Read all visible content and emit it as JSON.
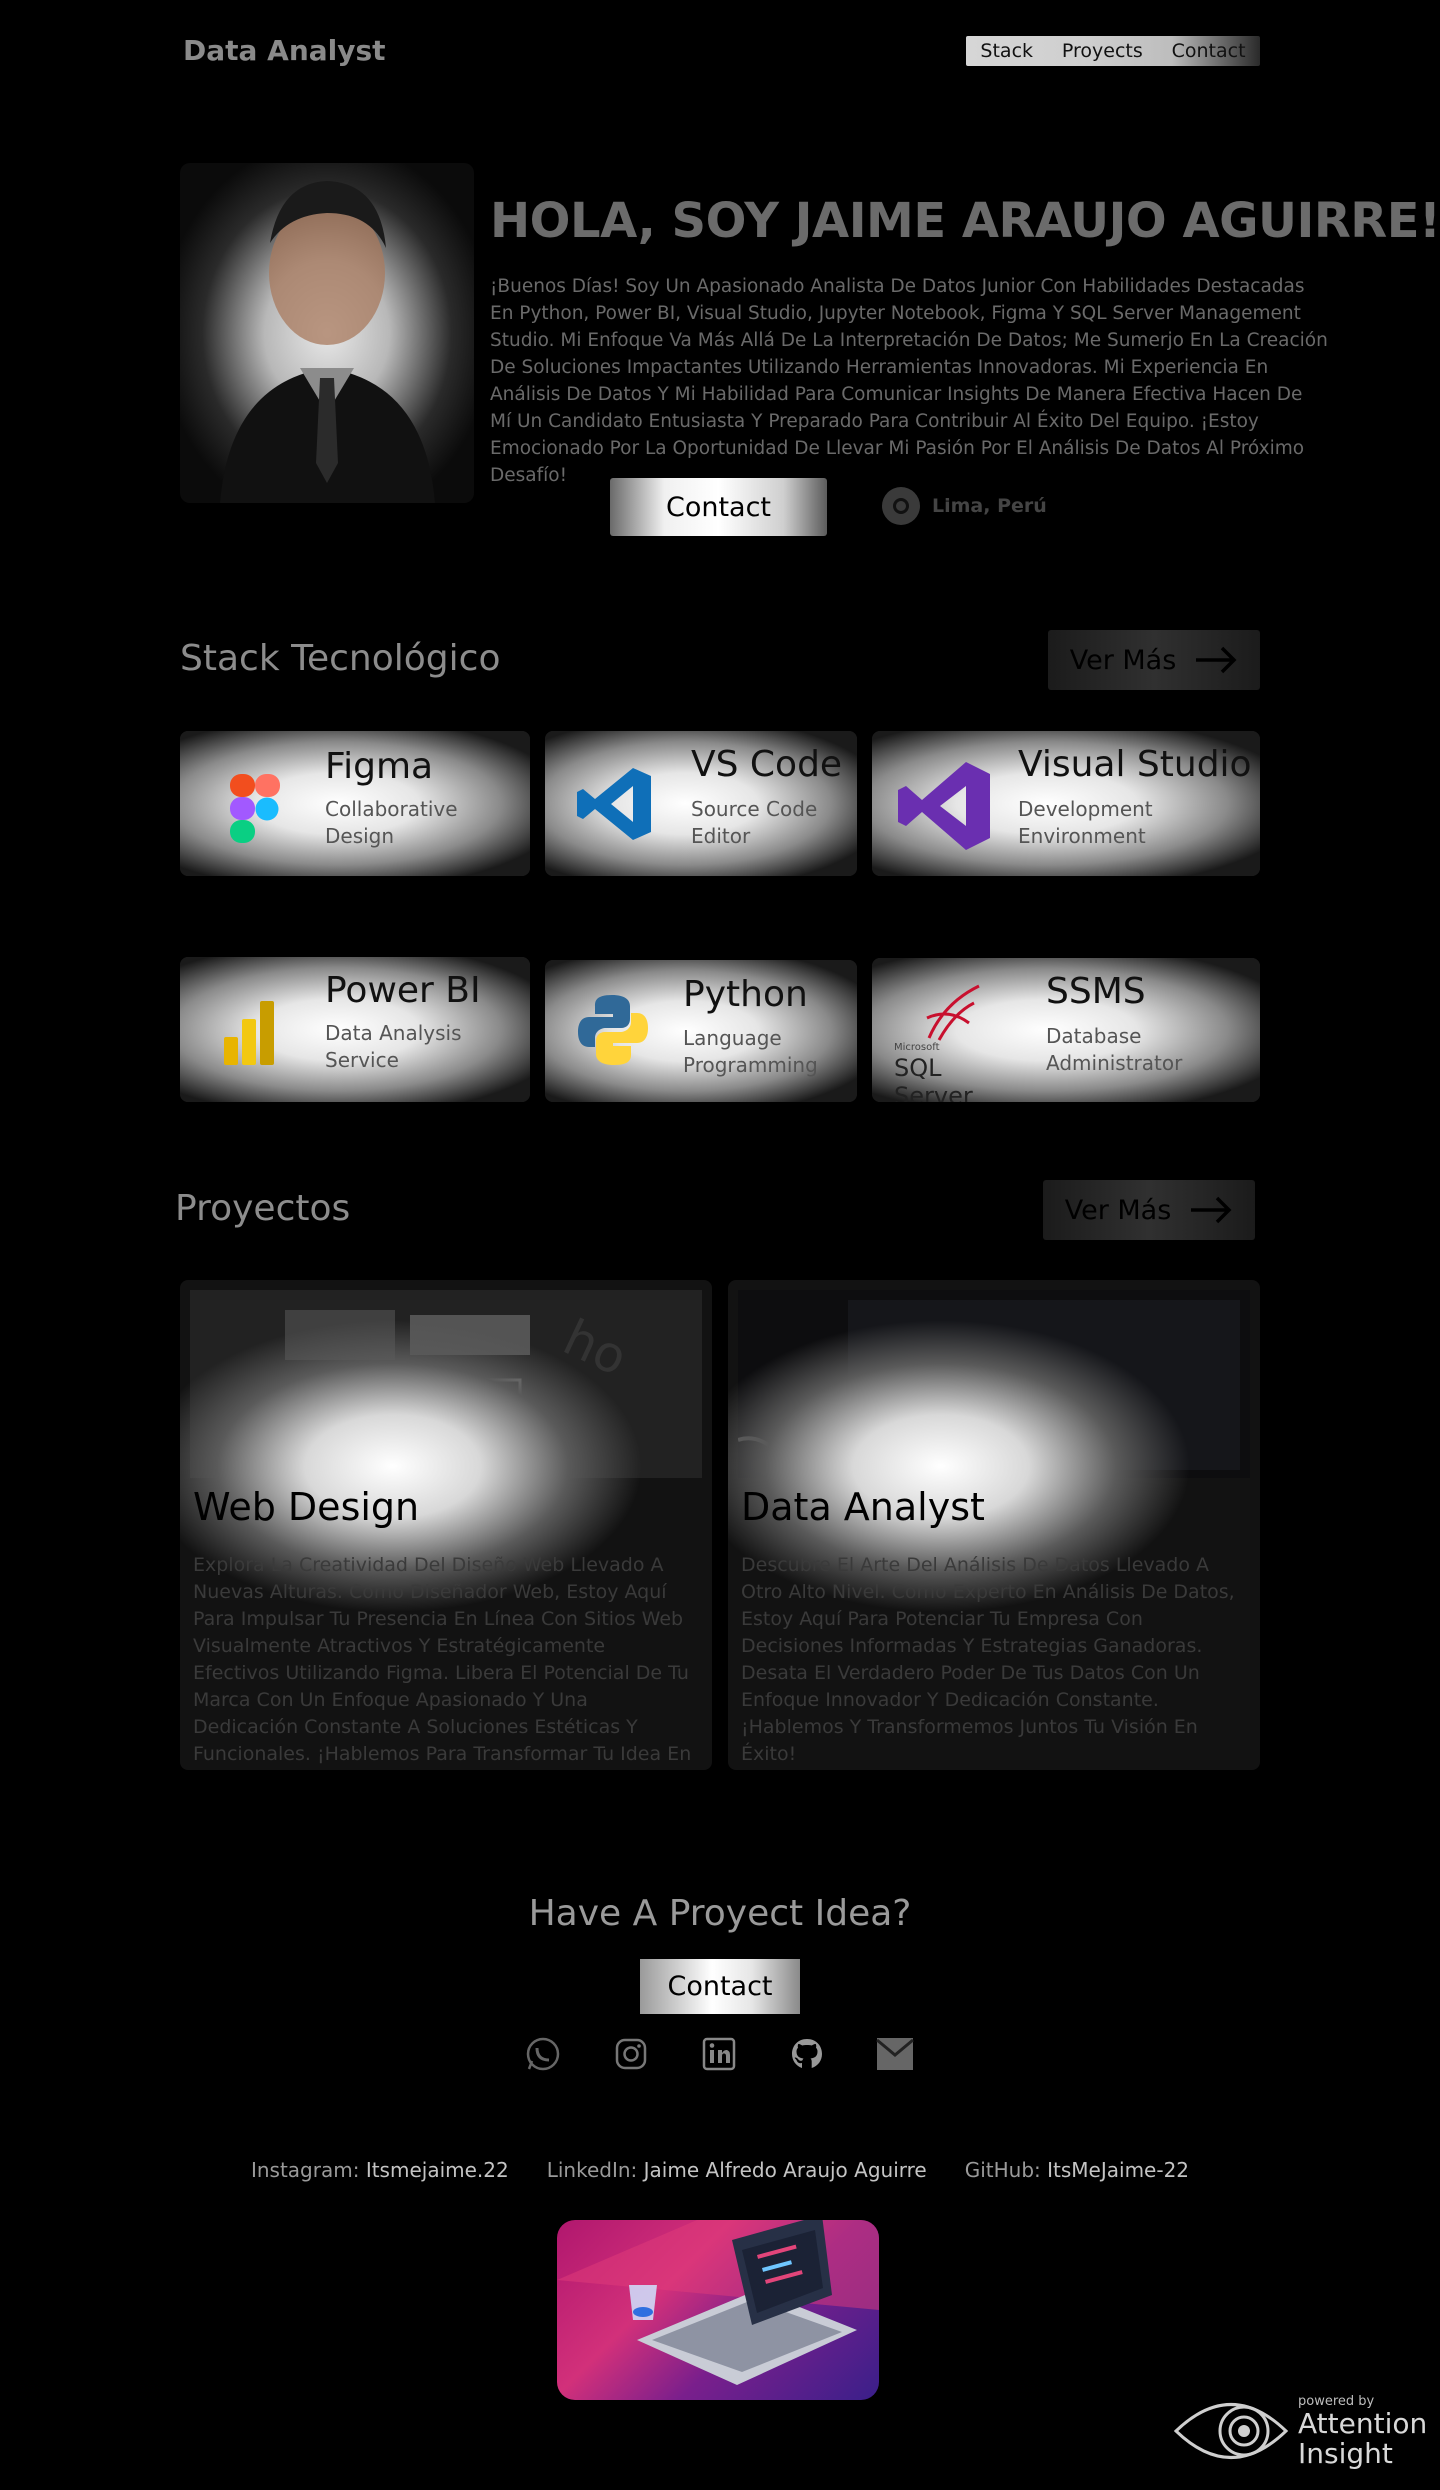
{
  "nav": {
    "brand": "Data Analyst",
    "links": [
      "Stack",
      "Proyects",
      "Contact"
    ]
  },
  "hero": {
    "title": "HOLA, SOY JAIME ARAUJO AGUIRRE!!",
    "description": "¡Buenos Días! Soy Un Apasionado Analista De Datos Junior Con Habilidades Destacadas En Python, Power BI, Visual Studio, Jupyter Notebook, Figma Y SQL Server Management Studio. Mi Enfoque Va Más Allá De La Interpretación De Datos; Me Sumerjo En La Creación De Soluciones Impactantes Utilizando Herramientas Innovadoras. Mi Experiencia En Análisis De Datos Y Mi Habilidad Para Comunicar Insights De Manera Efectiva Hacen De Mí Un Candidato Entusiasta Y Preparado Para Contribuir Al Éxito Del Equipo. ¡Estoy Emocionado Por La Oportunidad De Llevar Mi Pasión Por El Análisis De Datos Al Próximo Desafío!",
    "contact_label": "Contact",
    "location": "Lima, Perú"
  },
  "stack": {
    "title": "Stack Tecnológico",
    "more_label": "Ver Más",
    "items": [
      {
        "name": "Figma",
        "desc": "Collaborative Design"
      },
      {
        "name": "VS Code",
        "desc": "Source Code Editor"
      },
      {
        "name": "Visual Studio",
        "desc": "Development Environment"
      },
      {
        "name": "Power BI",
        "desc": "Data Analysis Service"
      },
      {
        "name": "Python",
        "desc": "Language Programming"
      },
      {
        "name": "SSMS",
        "desc": "Database Administrator"
      }
    ],
    "ssms_logo_small": "Microsoft",
    "ssms_logo_text": "SQL Server"
  },
  "projects": {
    "title": "Proyectos",
    "more_label": "Ver Más",
    "items": [
      {
        "title": "Web Design",
        "desc": "Explora La Creatividad Del Diseño Web Llevado A Nuevas Alturas. Como Diseñador Web, Estoy Aquí Para Impulsar Tu Presencia En Línea Con Sitios Web Visualmente Atractivos Y Estratégicamente Efectivos Utilizando Figma. Libera El Potencial De Tu Marca Con Un Enfoque Apasionado Y Una Dedicación Constante A Soluciones Estéticas Y Funcionales. ¡Hablemos Para Transformar Tu Idea En Realidad Digital!"
      },
      {
        "title": "Data Analyst",
        "desc": "Descubre El Arte Del Análisis De Datos Llevado A Otro Alto Nivel. Como Experto En Análisis De Datos, Estoy Aquí Para Potenciar Tu Empresa Con Decisiones Informadas Y Estrategias Ganadoras. Desata El Verdadero Poder De Tus Datos Con Un Enfoque Innovador Y Dedicación Constante. ¡Hablemos Y Transformemos Juntos Tu Visión En Éxito!"
      }
    ]
  },
  "contact": {
    "heading": "Have A Proyect Idea?",
    "button_label": "Contact",
    "socials": [
      "whatsapp-icon",
      "instagram-icon",
      "linkedin-icon",
      "github-icon",
      "mail-icon"
    ]
  },
  "footer": {
    "links": [
      {
        "label": "Instagram:",
        "value": "Itsmejaime.22"
      },
      {
        "label": "LinkedIn:",
        "value": "Jaime Alfredo Araujo Aguirre"
      },
      {
        "label": "GitHub:",
        "value": "ItsMeJaime-22"
      }
    ]
  },
  "watermark": {
    "powered_by": "powered by",
    "name_line1": "Attention",
    "name_line2": "Insight"
  }
}
